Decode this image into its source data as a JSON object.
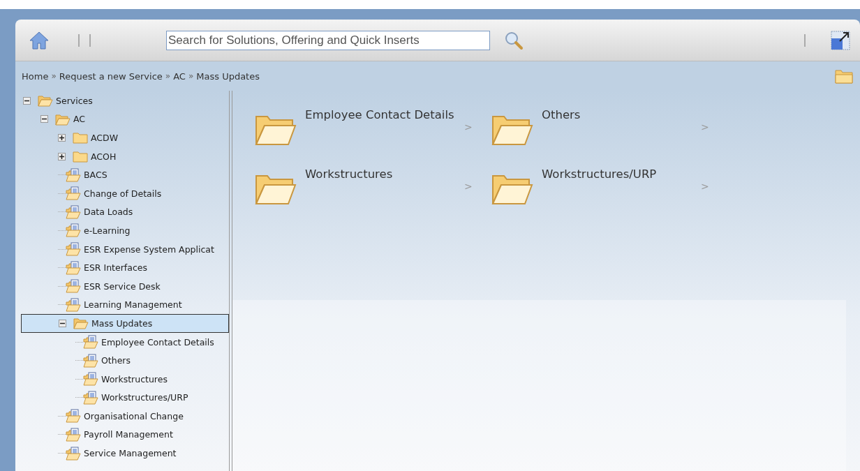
{
  "toolbar": {
    "search": {
      "placeholder": "Search for Solutions, Offering and Quick Inserts"
    }
  },
  "breadcrumb": [
    "Home",
    "Request a new Service",
    "AC",
    "Mass Updates"
  ],
  "breadcrumb_separator": "»",
  "tree": [
    {
      "label": "Services",
      "kind": "folder",
      "expanded": true,
      "selected": false,
      "children": [
        {
          "label": "AC",
          "kind": "folder",
          "expanded": true,
          "selected": false,
          "children": [
            {
              "label": "ACDW",
              "kind": "folder",
              "expanded": false,
              "selected": false
            },
            {
              "label": "ACOH",
              "kind": "folder",
              "expanded": false,
              "selected": false
            },
            {
              "label": "BACS",
              "kind": "document",
              "selected": false
            },
            {
              "label": "Change of Details",
              "kind": "document",
              "selected": false
            },
            {
              "label": "Data Loads",
              "kind": "document",
              "selected": false
            },
            {
              "label": "e-Learning",
              "kind": "document",
              "selected": false
            },
            {
              "label": "ESR Expense System Applicat",
              "kind": "document",
              "selected": false
            },
            {
              "label": "ESR Interfaces",
              "kind": "document",
              "selected": false
            },
            {
              "label": "ESR Service Desk",
              "kind": "document",
              "selected": false
            },
            {
              "label": "Learning Management",
              "kind": "document",
              "selected": false
            },
            {
              "label": "Mass Updates",
              "kind": "folder",
              "expanded": true,
              "selected": true,
              "children": [
                {
                  "label": "Employee Contact Details",
                  "kind": "document",
                  "selected": false
                },
                {
                  "label": "Others",
                  "kind": "document",
                  "selected": false
                },
                {
                  "label": "Workstructures",
                  "kind": "document",
                  "selected": false
                },
                {
                  "label": "Workstructures/URP",
                  "kind": "document",
                  "selected": false
                }
              ]
            },
            {
              "label": "Organisational Change",
              "kind": "document",
              "selected": false
            },
            {
              "label": "Payroll Management",
              "kind": "document",
              "selected": false
            },
            {
              "label": "Service Management",
              "kind": "document",
              "selected": false
            }
          ]
        }
      ]
    }
  ],
  "tiles": [
    {
      "label": "Employee Contact Details",
      "arrow": ">"
    },
    {
      "label": "Others",
      "arrow": ">"
    },
    {
      "label": "Workstructures",
      "arrow": ">"
    },
    {
      "label": "Workstructures/URP",
      "arrow": ">"
    }
  ]
}
